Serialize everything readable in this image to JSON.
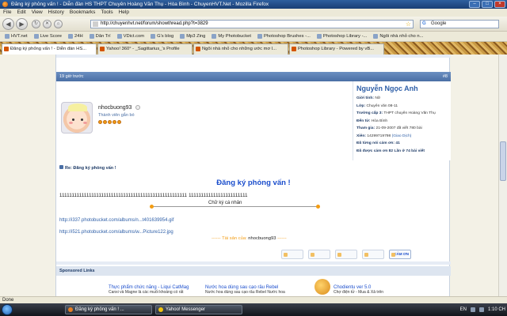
{
  "window": {
    "title": "Đăng ký phỏng vấn ! - Diễn đàn HS THPT Chuyên Hoàng Văn Thụ - Hòa Bình - ChuyenHVT.Net - Mozilla Firefox"
  },
  "menu": [
    "File",
    "Edit",
    "View",
    "History",
    "Bookmarks",
    "Tools",
    "Help"
  ],
  "nav": {
    "url": "http://chuyenhvt.net/forum/showthread.php?t=3829",
    "search_placeholder": "Google"
  },
  "bookmarks": [
    "HVT.net",
    "Live Score",
    "24H",
    "Dân Trí",
    "VDict.com",
    "G's blog",
    "Mp3 Zing",
    "My Photobucket",
    "Photoshop Brushes -...",
    "Photoshop Library -...",
    "Ngôi nhà nhỏ cho n..."
  ],
  "tabs": [
    "Đăng ký phỏng vấn ! - Diễn đàn HS...",
    "Yahoo! 360° - _Sagittarius_'s Profile",
    "Ngôi nhà nhỏ cho những ước mơ l...",
    "Photoshop Library - Powered by vB..."
  ],
  "post": {
    "header_time": "19 giờ trước",
    "header_num": "#8",
    "username": "nhocbuong93",
    "user_title": "Thành viên gắn bó",
    "fullname": "Nguyễn Ngọc Anh",
    "details": [
      {
        "label": "Giới tính:",
        "value": "Nữ"
      },
      {
        "label": "Lớp:",
        "value": "Chuyên văn 08-11"
      },
      {
        "label": "Trường cấp 3:",
        "value": "THPT chuyên Hoàng Văn Thụ"
      },
      {
        "label": "Đến từ:",
        "value": "Hòa Bình"
      },
      {
        "label": "Tham gia:",
        "value": "21-09-2007 đã viết 780 bài"
      },
      {
        "label": "Xiên:",
        "value": "14299719798",
        "link": "(Giao Dịch)"
      }
    ],
    "thanks_given": "Đã từng nói cảm ơn: 41",
    "thanks_received": "Đã được cảm ơn 82 Lần ở 74 bài viết",
    "reply_title": "Re: Đăng ký phỏng vấn !",
    "message_title": "Đăng ký phỏng vấn !",
    "message_text": "1111111111111111111111111111111111111111111111111111 111111111111111111111111",
    "signature_label": "Chữ ký cá nhân",
    "link1": "http://i337.photobucket.com/albums/n...t401639954.gif",
    "link2": "http://i521.photobucket.com/albums/w...Picture122.jpg",
    "assets_prefix": "------ Tài sản của:",
    "assets_owner": "nhocbuong93",
    "assets_suffix": "------",
    "buttons": [
      "",
      "",
      "",
      "",
      "CẢM ƠN"
    ]
  },
  "sponsored": {
    "title": "Sponsored Links",
    "ads": [
      {
        "title": "Thực phẩm chức năng - Liqui CatMag",
        "desc": "Canxi và Magne là các muối khoáng có rất"
      },
      {
        "title": "Nước hoa dùng sau cạo râu Rebel",
        "desc": "Nước hoa dùng sau cạo râu Rebel Nước hoa"
      },
      {
        "title": "Chodientu ver 5.0",
        "desc": "Chợ điện tử - Mua & Xả trên"
      }
    ]
  },
  "statusbar": {
    "text": "Done"
  },
  "taskbar": {
    "tasks": [
      "Đăng ký phỏng vấn ! ...",
      "Yahoo! Messenger"
    ],
    "lang": "EN",
    "clock": "1:10 CH"
  }
}
